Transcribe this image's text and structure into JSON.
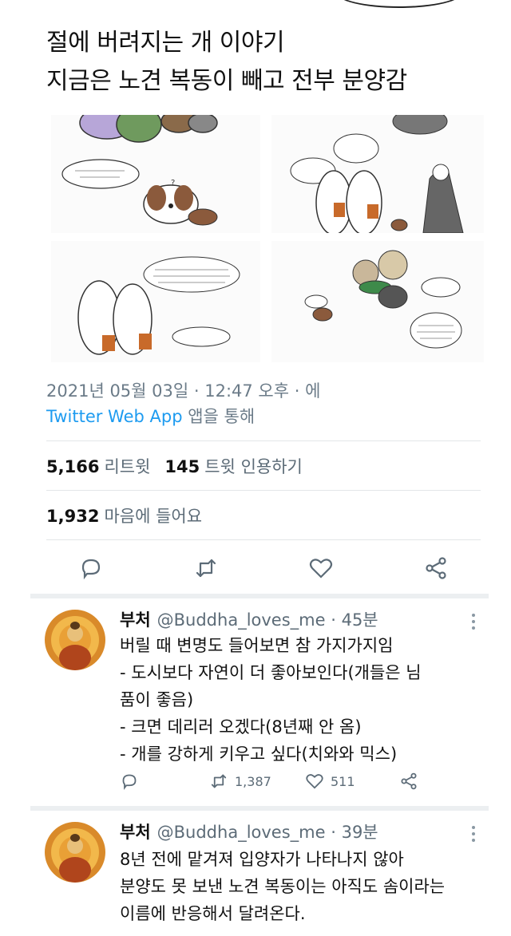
{
  "tweet": {
    "text_lines": [
      "절에 버려지는 개 이야기",
      "지금은 노견 복동이 빼고 전부 분양감"
    ],
    "timestamp": "2021년 05월 03일 · 12:47 오후 · 에",
    "via_app": "Twitter Web App",
    "via_suffix": " 앱을 통해",
    "retweets_count": "5,166",
    "retweets_label": "리트윗",
    "quotes_count": "145",
    "quotes_label": "트윗 인용하기",
    "likes_count": "1,932",
    "likes_label": "마음에 들어요"
  },
  "replies": [
    {
      "name": "부처",
      "handle": "@Buddha_loves_me",
      "time": "· 45분",
      "lines": [
        "버릴 때 변명도 들어보면 참 가지가지임",
        "- 도시보다 자연이 더 좋아보인다(개들은 님",
        "품이 좋음)",
        "- 크면 데리러 오겠다(8년째 안 옴)",
        "- 개를 강하게 키우고 싶다(치와와 믹스)"
      ],
      "retweets": "1,387",
      "likes": "511"
    },
    {
      "name": "부처",
      "handle": "@Buddha_loves_me",
      "time": "· 39분",
      "lines": [
        "8년 전에 맡겨져 입양자가 나타나지 않아",
        "분양도 못 보낸 노견 복동이는 아직도 솜이라는",
        "이름에 반응해서 달려온다."
      ]
    }
  ],
  "colors": {
    "link_blue": "#1d9bf0",
    "meta_gray": "#6b7b88",
    "divider": "#e3e6e8"
  },
  "icons": [
    "reply-icon",
    "retweet-icon",
    "like-icon",
    "share-icon",
    "more-icon"
  ]
}
